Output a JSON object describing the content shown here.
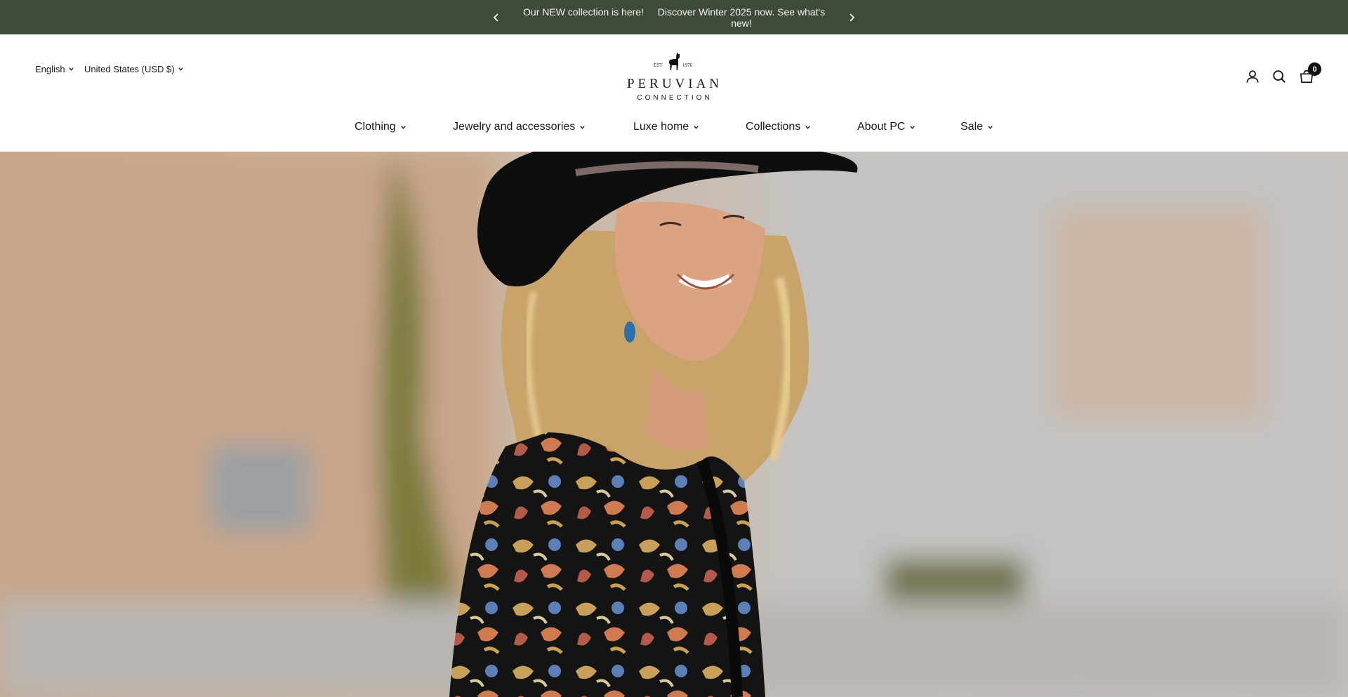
{
  "announcement": {
    "message_1": "Our NEW collection is here!",
    "message_2": "Discover Winter 2025 now. See what's new!",
    "prev_icon": "chevron-left-icon",
    "next_icon": "chevron-right-icon",
    "background_color": "#3f4a3a"
  },
  "header": {
    "language": "English",
    "currency": "United States (USD $)",
    "logo": {
      "est_left": "EST",
      "est_right": "1976",
      "brand": "PERUVIAN",
      "brand_sub": "CONNECTION"
    },
    "icons": {
      "account": "account-icon",
      "search": "search-icon",
      "cart": "cart-icon"
    },
    "cart_count": "0"
  },
  "nav": {
    "items": [
      {
        "label": "Clothing"
      },
      {
        "label": "Jewelry and accessories"
      },
      {
        "label": "Luxe home"
      },
      {
        "label": "Collections"
      },
      {
        "label": "About PC"
      },
      {
        "label": "Sale"
      }
    ]
  }
}
